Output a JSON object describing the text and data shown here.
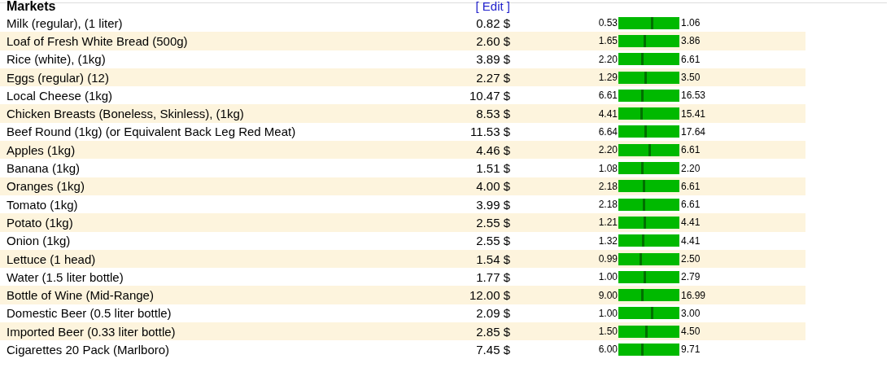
{
  "section": {
    "title": "Markets",
    "edit_link": "[ Edit ]"
  },
  "rows": [
    {
      "name": "Milk (regular), (1 liter)",
      "price": "0.82 $",
      "min": "0.53",
      "max": "1.06",
      "level": 0.55
    },
    {
      "name": "Loaf of Fresh White Bread (500g)",
      "price": "2.60 $",
      "min": "1.65",
      "max": "3.86",
      "level": 0.43
    },
    {
      "name": "Rice (white), (1kg)",
      "price": "3.89 $",
      "min": "2.20",
      "max": "6.61",
      "level": 0.38
    },
    {
      "name": "Eggs (regular) (12)",
      "price": "2.27 $",
      "min": "1.29",
      "max": "3.50",
      "level": 0.44
    },
    {
      "name": "Local Cheese (1kg)",
      "price": "10.47 $",
      "min": "6.61",
      "max": "16.53",
      "level": 0.39
    },
    {
      "name": "Chicken Breasts (Boneless, Skinless), (1kg)",
      "price": "8.53 $",
      "min": "4.41",
      "max": "15.41",
      "level": 0.37
    },
    {
      "name": "Beef Round (1kg) (or Equivalent Back Leg Red Meat)",
      "price": "11.53 $",
      "min": "6.64",
      "max": "17.64",
      "level": 0.44
    },
    {
      "name": "Apples (1kg)",
      "price": "4.46 $",
      "min": "2.20",
      "max": "6.61",
      "level": 0.51
    },
    {
      "name": "Banana (1kg)",
      "price": "1.51 $",
      "min": "1.08",
      "max": "2.20",
      "level": 0.38
    },
    {
      "name": "Oranges (1kg)",
      "price": "4.00 $",
      "min": "2.18",
      "max": "6.61",
      "level": 0.41
    },
    {
      "name": "Tomato (1kg)",
      "price": "3.99 $",
      "min": "2.18",
      "max": "6.61",
      "level": 0.41
    },
    {
      "name": "Potato (1kg)",
      "price": "2.55 $",
      "min": "1.21",
      "max": "4.41",
      "level": 0.42
    },
    {
      "name": "Onion (1kg)",
      "price": "2.55 $",
      "min": "1.32",
      "max": "4.41",
      "level": 0.4
    },
    {
      "name": "Lettuce (1 head)",
      "price": "1.54 $",
      "min": "0.99",
      "max": "2.50",
      "level": 0.36
    },
    {
      "name": "Water (1.5 liter bottle)",
      "price": "1.77 $",
      "min": "1.00",
      "max": "2.79",
      "level": 0.43
    },
    {
      "name": "Bottle of Wine (Mid-Range)",
      "price": "12.00 $",
      "min": "9.00",
      "max": "16.99",
      "level": 0.38
    },
    {
      "name": "Domestic Beer (0.5 liter bottle)",
      "price": "2.09 $",
      "min": "1.00",
      "max": "3.00",
      "level": 0.54
    },
    {
      "name": "Imported Beer (0.33 liter bottle)",
      "price": "2.85 $",
      "min": "1.50",
      "max": "4.50",
      "level": 0.45
    },
    {
      "name": "Cigarettes 20 Pack (Marlboro)",
      "price": "7.45 $",
      "min": "6.00",
      "max": "9.71",
      "level": 0.39
    }
  ]
}
